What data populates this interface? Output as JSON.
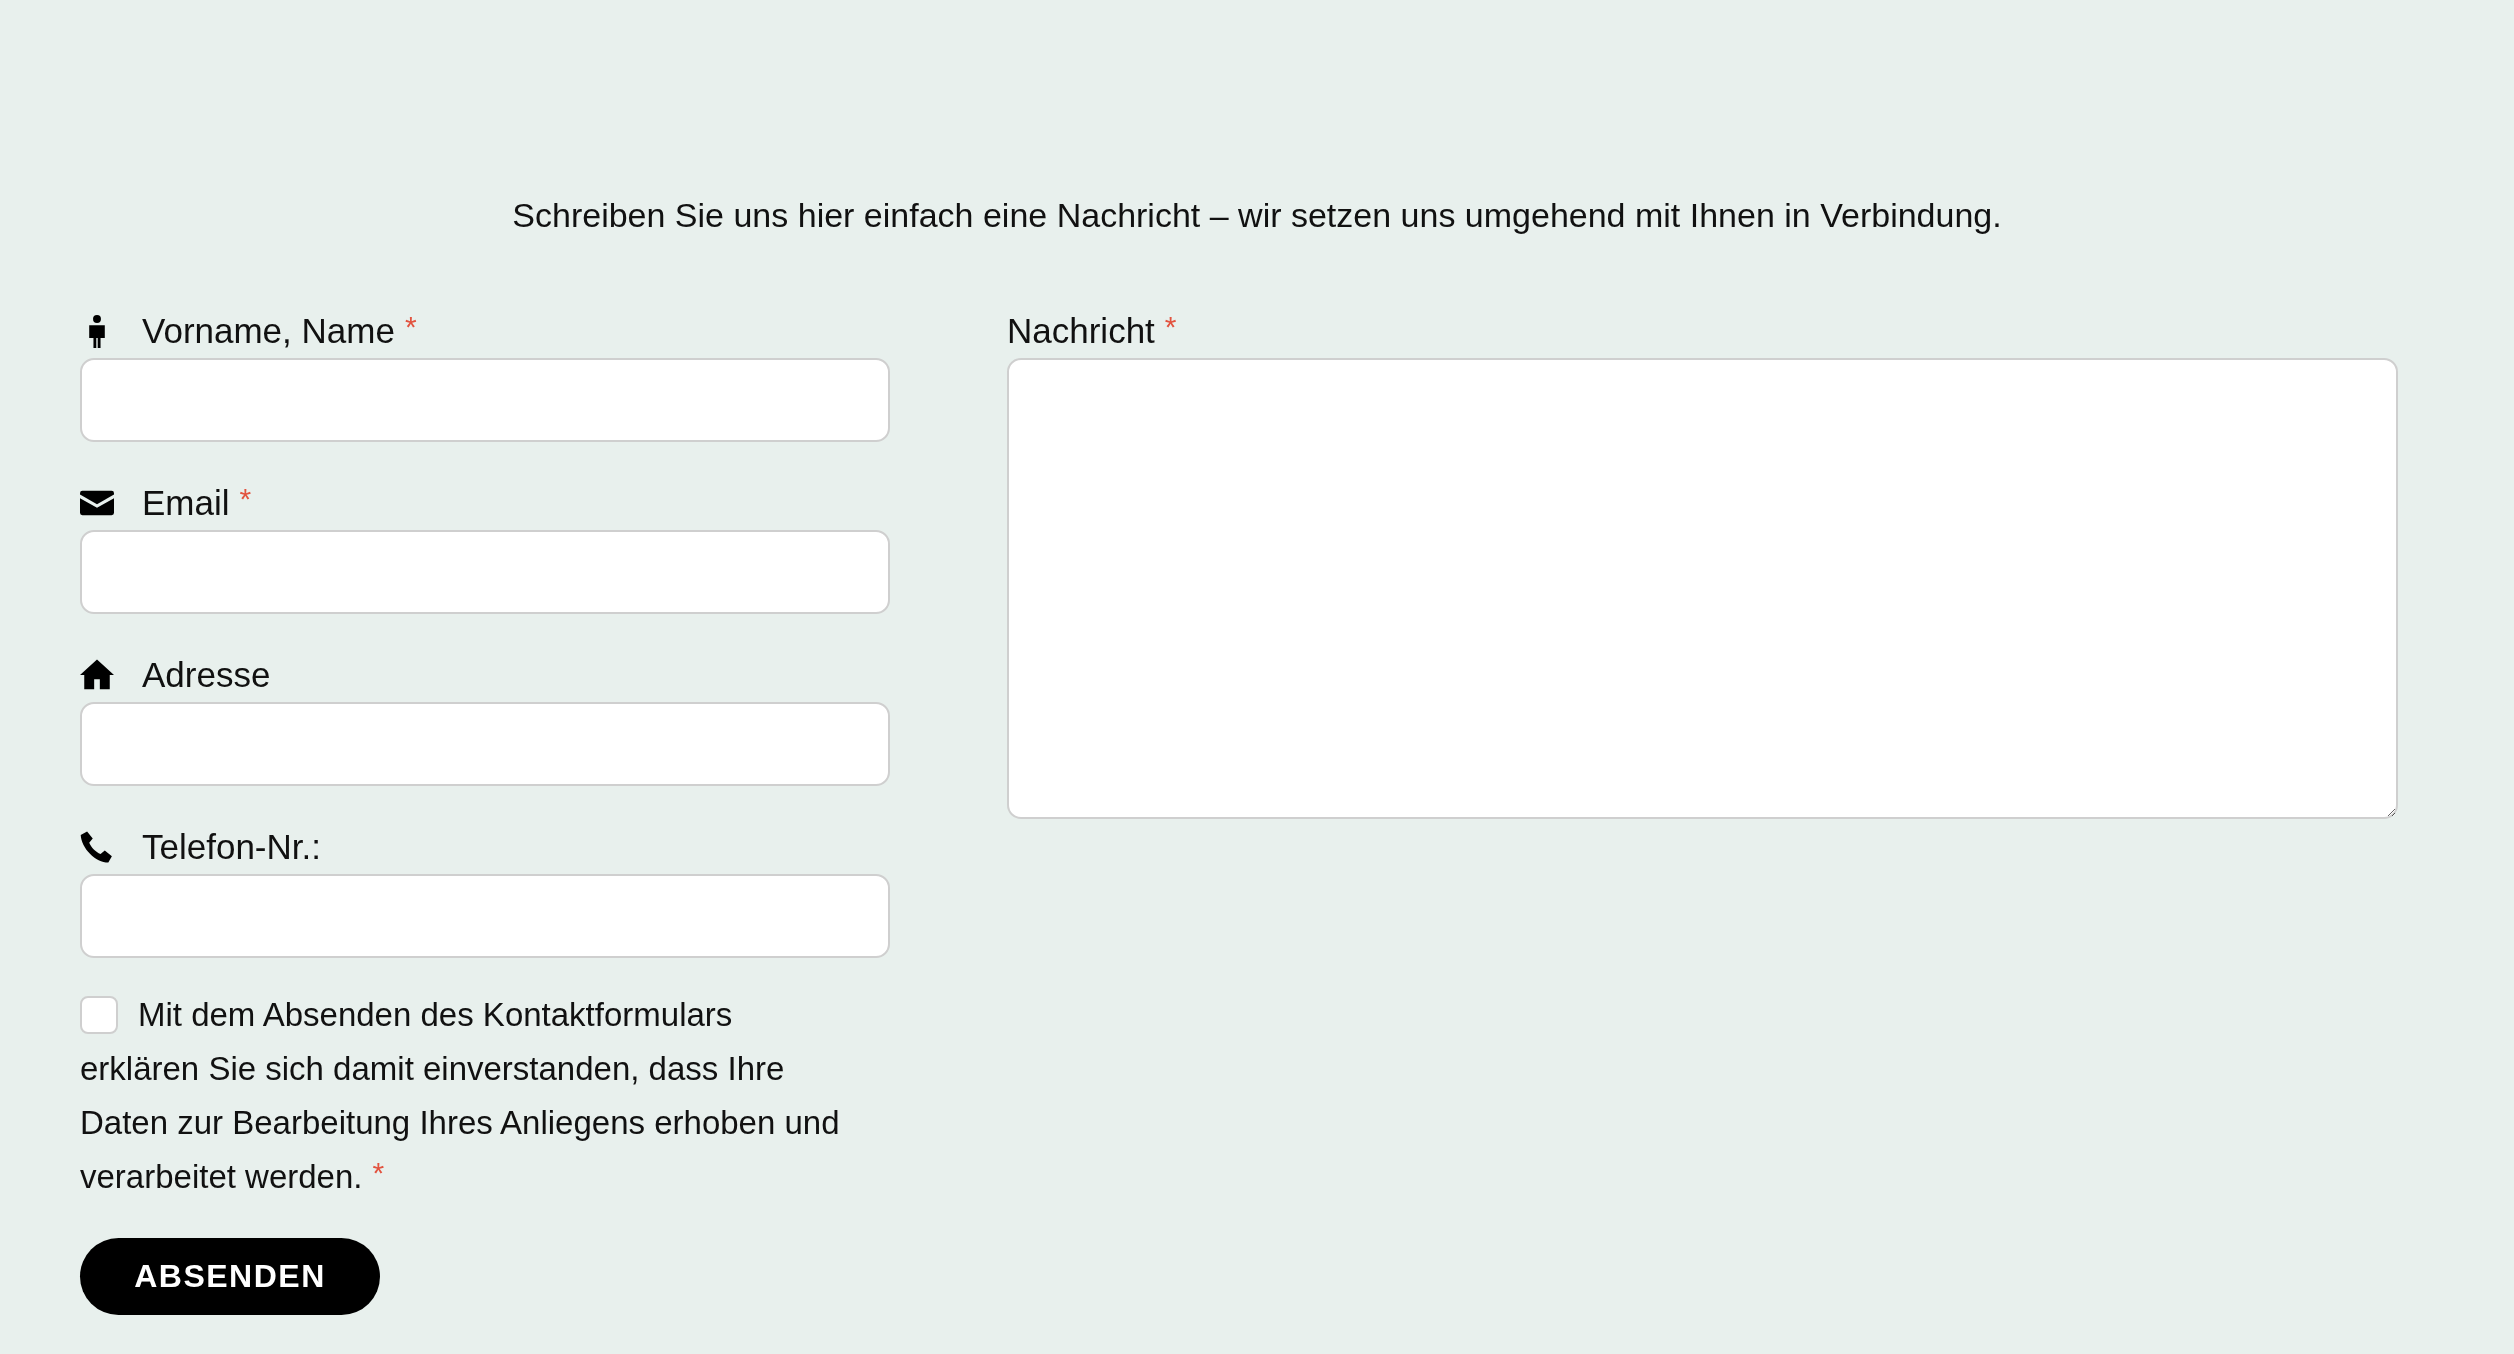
{
  "intro": "Schreiben Sie uns hier einfach eine Nachricht – wir setzen uns umgehend mit Ihnen in Verbindung.",
  "fields": [
    {
      "kind": "person",
      "label": "Vorname, Name",
      "required_mark": "*"
    },
    {
      "kind": "envelope",
      "label": "Email",
      "required_mark": "*"
    },
    {
      "kind": "house",
      "label": "Adresse"
    },
    {
      "kind": "phone",
      "label": "Telefon-Nr.:"
    }
  ],
  "consent": {
    "checked": false,
    "lines": [
      "Mit dem Absenden des Kontaktformulars",
      "erklären Sie sich damit einverstanden, dass Ihre",
      "Daten zur Bearbeitung Ihres Anliegens erhoben und",
      "verarbeitet werden."
    ],
    "required_mark": "*"
  },
  "submit": "ABSENDEN",
  "message": {
    "label": "Nachricht",
    "required_mark": "*"
  }
}
